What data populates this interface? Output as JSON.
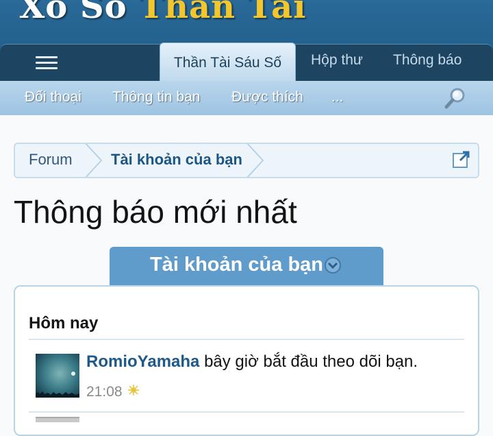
{
  "site": {
    "logo_part1": "Xổ Số",
    "logo_part2": "Thần Tài"
  },
  "nav": {
    "menu_icon": "hamburger-menu-icon",
    "tabs": [
      {
        "label": "Thần Tài Sáu Số",
        "active": true
      },
      {
        "label": "Hộp thư",
        "active": false
      },
      {
        "label": "Thông báo",
        "active": false
      }
    ],
    "subnav": [
      "Đối thoại",
      "Thông tin bạn",
      "Được thích",
      "..."
    ],
    "search_icon": "magnifier-search-icon"
  },
  "breadcrumb": {
    "items": [
      "Forum",
      "Tài khoản của bạn"
    ],
    "external_icon": "external-link-icon"
  },
  "page_title": "Thông báo mới nhất",
  "filter": {
    "label": "Tài khoản của bạn",
    "icon": "chevron-down-circle-icon"
  },
  "notifications": {
    "group_heading": "Hôm nay",
    "items": [
      {
        "user": "RomioYamaha",
        "action": "bây giờ bắt đầu theo dõi bạn.",
        "time": "21:08",
        "new_icon": "sparkle-new-icon"
      }
    ]
  },
  "colors": {
    "header": "#1d5a86",
    "nav_dark": "#1d4561",
    "subnav": "#9dc3e2",
    "accent": "#5f9bcb",
    "link": "#1d5a8a",
    "logo_gold": "#f2c62e"
  }
}
